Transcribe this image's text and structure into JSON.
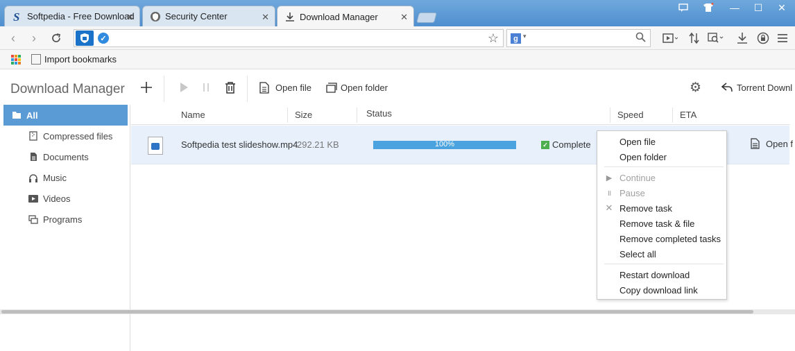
{
  "tabs": [
    {
      "label": "Softpedia - Free Download",
      "icon": "softpedia-icon"
    },
    {
      "label": "Security Center",
      "icon": "shield-icon"
    },
    {
      "label": "Download Manager",
      "icon": "download-icon"
    }
  ],
  "window_controls": {
    "minimize": "—",
    "maximize": "☐",
    "close": "✕"
  },
  "address_bar": {
    "url": "",
    "search_engine": "g"
  },
  "bookmarks": {
    "import_label": "Import bookmarks"
  },
  "app": {
    "title": "Download Manager",
    "toolbar": {
      "open_file": "Open file",
      "open_folder": "Open folder",
      "torrent": "Torrent Downl"
    },
    "sidebar": [
      {
        "label": "All",
        "icon": "folder-icon",
        "selected": true
      },
      {
        "label": "Compressed files",
        "icon": "archive-icon"
      },
      {
        "label": "Documents",
        "icon": "document-icon"
      },
      {
        "label": "Music",
        "icon": "headphones-icon"
      },
      {
        "label": "Videos",
        "icon": "video-icon"
      },
      {
        "label": "Programs",
        "icon": "window-icon"
      }
    ],
    "columns": {
      "name": "Name",
      "size": "Size",
      "status": "Status",
      "speed": "Speed",
      "eta": "ETA"
    },
    "downloads": [
      {
        "name": "Softpedia test slideshow.mp4",
        "size": "292.21 KB",
        "progress": 1.0,
        "progress_label": "100%",
        "status": "Complete",
        "action": "Open f"
      }
    ]
  },
  "context_menu": {
    "items": [
      {
        "label": "Open file",
        "enabled": true
      },
      {
        "label": "Open folder",
        "enabled": true
      },
      {
        "label": "Continue",
        "enabled": false,
        "icon": "play-icon"
      },
      {
        "label": "Pause",
        "enabled": false,
        "icon": "pause-icon"
      },
      {
        "label": "Remove task",
        "enabled": true,
        "icon": "close-icon"
      },
      {
        "label": "Remove task & file",
        "enabled": true
      },
      {
        "label": "Remove completed tasks",
        "enabled": true
      },
      {
        "label": "Select all",
        "enabled": true
      },
      {
        "label": "Restart download",
        "enabled": true
      },
      {
        "label": "Copy download link",
        "enabled": true
      }
    ]
  },
  "colors": {
    "accent": "#5b9bd5",
    "progress": "#4aa3df",
    "complete": "#4cae4c",
    "selected_row": "#e7f0fb"
  }
}
